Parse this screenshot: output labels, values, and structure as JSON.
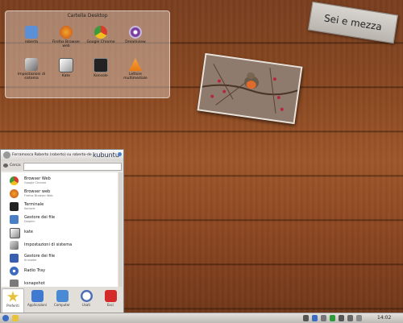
{
  "folder_view": {
    "title": "Cartella Desktop",
    "icons": [
      {
        "label": "roberto",
        "icon": "home-folder-icon",
        "color": "#5b8fd6"
      },
      {
        "label": "Firefox Browser web",
        "icon": "firefox-icon",
        "color": "#d86a1c"
      },
      {
        "label": "Google Chrome",
        "icon": "chrome-icon",
        "color": "#3c9a3c"
      },
      {
        "label": "Dreamview",
        "icon": "eye-icon",
        "color": "#7a3fa0"
      },
      {
        "label": "Impostazioni di sistema",
        "icon": "settings-icon",
        "color": "#6a6a6a"
      },
      {
        "label": "Kate",
        "icon": "kate-icon",
        "color": "#555555"
      },
      {
        "label": "Konsole",
        "icon": "terminal-icon",
        "color": "#222222"
      },
      {
        "label": "Lettore multimediale",
        "icon": "vlc-icon",
        "color": "#e87a12"
      }
    ]
  },
  "sticky_note": {
    "text": "Sei e mezza"
  },
  "launcher": {
    "user": "Ferramosca Roberto (roberto) su roberto-de",
    "brand": "kubuntu",
    "search_label": "Cerca:",
    "search_value": "",
    "favorites": [
      {
        "title": "Browser Web",
        "subtitle": "Google Chrome",
        "icon": "chrome-icon",
        "color": "#3c9a3c"
      },
      {
        "title": "Browser web",
        "subtitle": "Firefox Browser Web",
        "icon": "firefox-icon",
        "color": "#d86a1c"
      },
      {
        "title": "Terminale",
        "subtitle": "Konsole",
        "icon": "terminal-icon",
        "color": "#222222"
      },
      {
        "title": "Gestore dei file",
        "subtitle": "Dolphin",
        "icon": "folder-icon",
        "color": "#4a7fc6"
      },
      {
        "title": "kate",
        "subtitle": "",
        "icon": "kate-icon",
        "color": "#555555"
      },
      {
        "title": "Impostazioni di sistema",
        "subtitle": "",
        "icon": "settings-icon",
        "color": "#6a6a6a"
      },
      {
        "title": "Gestore dei file",
        "subtitle": "Krusader",
        "icon": "krusader-icon",
        "color": "#3a5fae"
      },
      {
        "title": "Radio Tray",
        "subtitle": "",
        "icon": "radio-icon",
        "color": "#3b6cc1"
      },
      {
        "title": "ksnapshot",
        "subtitle": "",
        "icon": "camera-icon",
        "color": "#7a7a7a"
      }
    ],
    "tabs": [
      {
        "label": "Preferiti",
        "icon": "star-icon",
        "color": "#e7c23a"
      },
      {
        "label": "Applicazioni",
        "icon": "apps-icon",
        "color": "#3f7ad0"
      },
      {
        "label": "Computer",
        "icon": "computer-icon",
        "color": "#4a8ad4"
      },
      {
        "label": "Usati",
        "icon": "clock-icon",
        "color": "#4b6db5"
      },
      {
        "label": "Esci",
        "icon": "power-icon",
        "color": "#d42a2a"
      }
    ]
  },
  "taskbar": {
    "clock": "14:02"
  }
}
